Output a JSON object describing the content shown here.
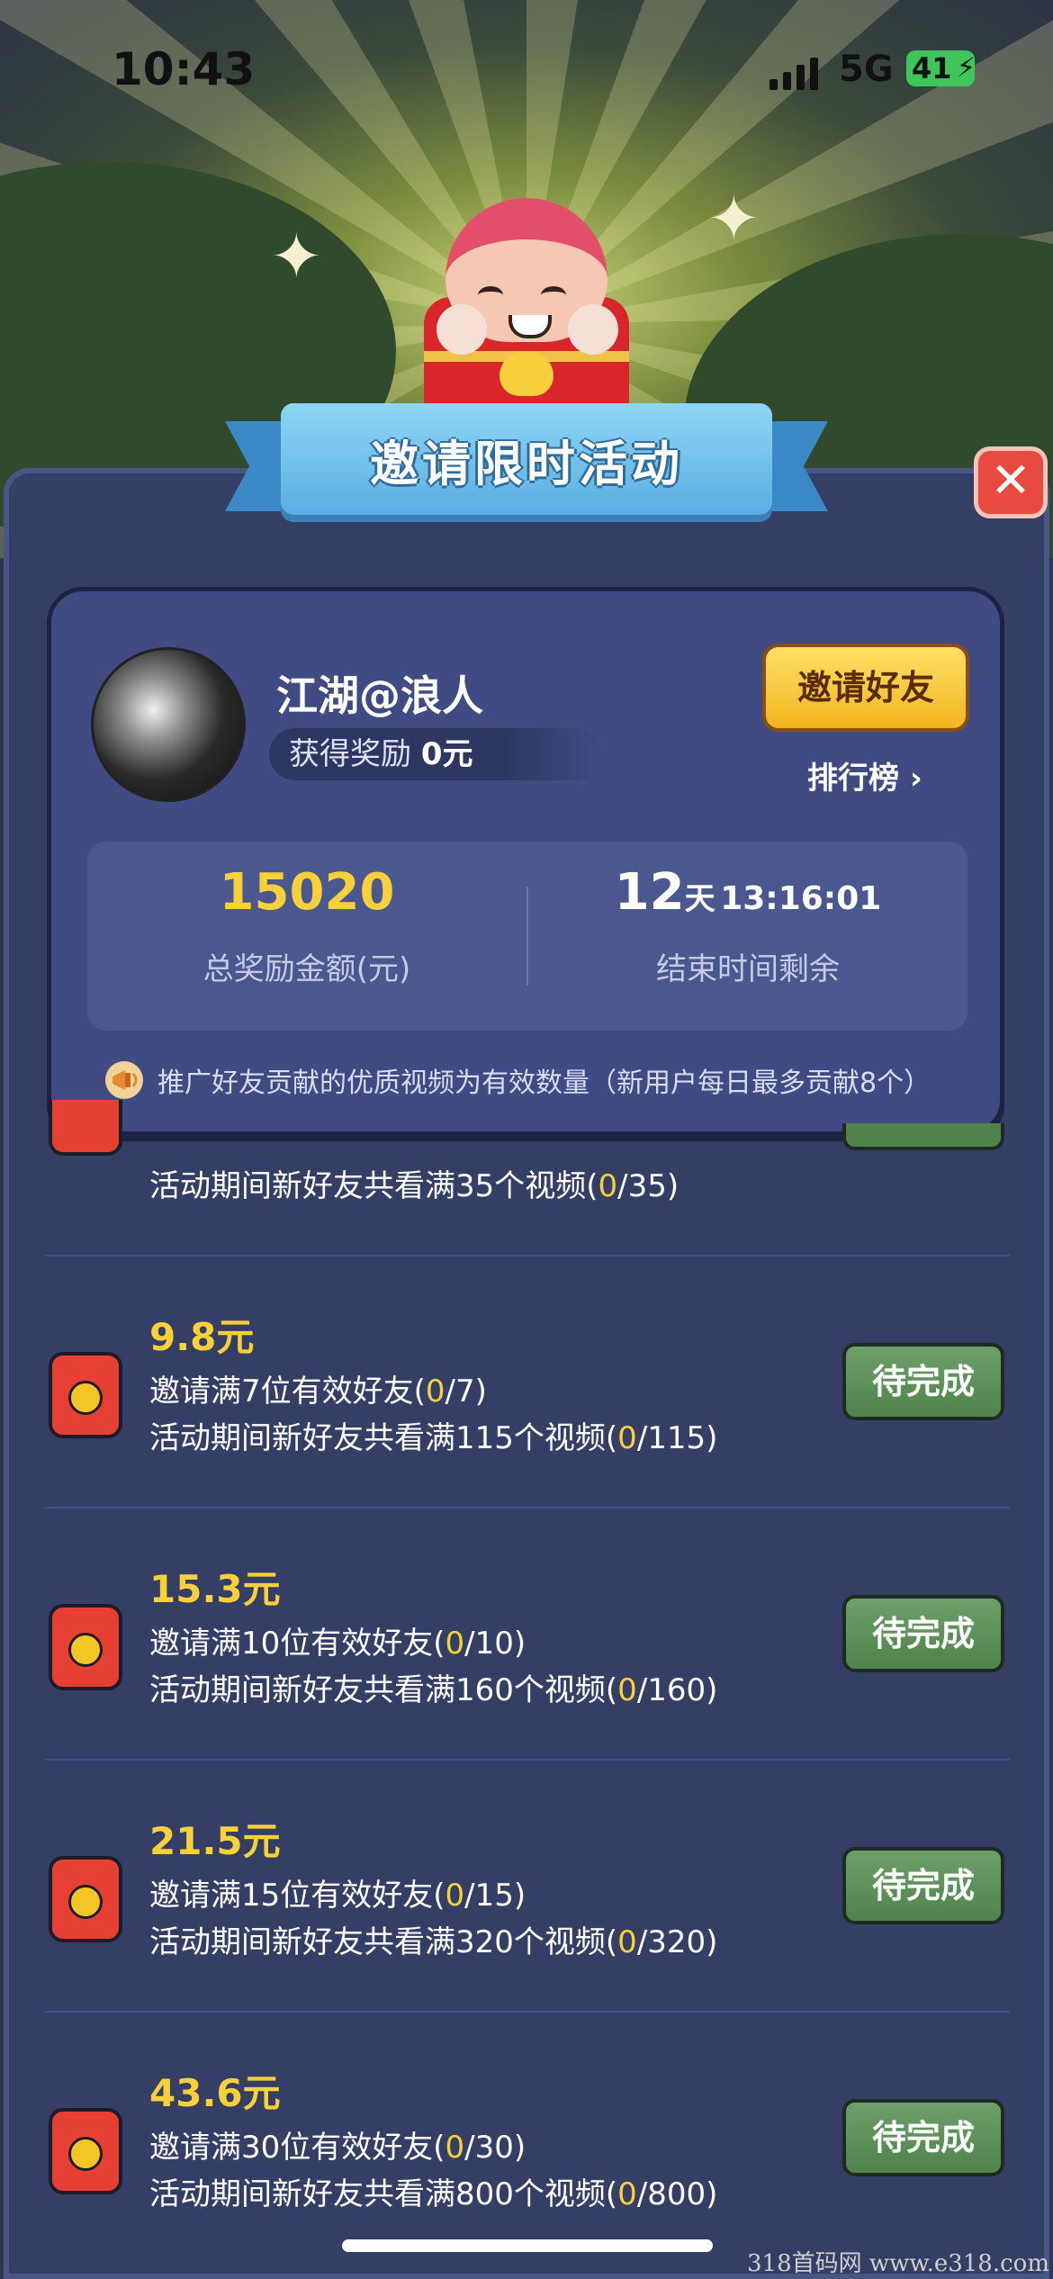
{
  "status_bar": {
    "time": "10:43",
    "network": "5G",
    "battery": "41"
  },
  "banner": {
    "title": "邀请限时活动",
    "close_label": "✕"
  },
  "user": {
    "name": "江湖@浪人",
    "reward_label": "获得奖励",
    "reward_value": "0元",
    "invite_button": "邀请好友",
    "ranking_link": "排行榜 ›"
  },
  "stats": {
    "total_amount": "15020",
    "total_amount_label": "总奖励金额(元)",
    "remaining_days": "12",
    "remaining_days_unit": "天",
    "remaining_clock": "13:16:01",
    "remaining_label": "结束时间剩余"
  },
  "notice": "推广好友贡献的优质视频为有效数量（新用户每日最多贡献8个）",
  "tasks": [
    {
      "line1_prefix": "活动期间新好友共看满35个视频(",
      "line1_progress": "0",
      "line1_suffix": "/35)"
    },
    {
      "amount": "9.8元",
      "line1_prefix": "邀请满7位有效好友(",
      "line1_progress": "0",
      "line1_suffix": "/7)",
      "line2_prefix": "活动期间新好友共看满115个视频(",
      "line2_progress": "0",
      "line2_suffix": "/115)",
      "button": "待完成"
    },
    {
      "amount": "15.3元",
      "line1_prefix": "邀请满10位有效好友(",
      "line1_progress": "0",
      "line1_suffix": "/10)",
      "line2_prefix": "活动期间新好友共看满160个视频(",
      "line2_progress": "0",
      "line2_suffix": "/160)",
      "button": "待完成"
    },
    {
      "amount": "21.5元",
      "line1_prefix": "邀请满15位有效好友(",
      "line1_progress": "0",
      "line1_suffix": "/15)",
      "line2_prefix": "活动期间新好友共看满320个视频(",
      "line2_progress": "0",
      "line2_suffix": "/320)",
      "button": "待完成"
    },
    {
      "amount": "43.6元",
      "line1_prefix": "邀请满30位有效好友(",
      "line1_progress": "0",
      "line1_suffix": "/30)",
      "line2_prefix": "活动期间新好友共看满800个视频(",
      "line2_progress": "0",
      "line2_suffix": "/800)",
      "button": "待完成"
    }
  ],
  "watermark": "318首码网  www.e318.com",
  "colors": {
    "panel": "#353f66",
    "card": "#3f4b82",
    "accent_yellow": "#f7d03a",
    "button_green": "#5b8f57",
    "close_red": "#e84a3f",
    "ribbon_blue": "#5aaee2"
  }
}
